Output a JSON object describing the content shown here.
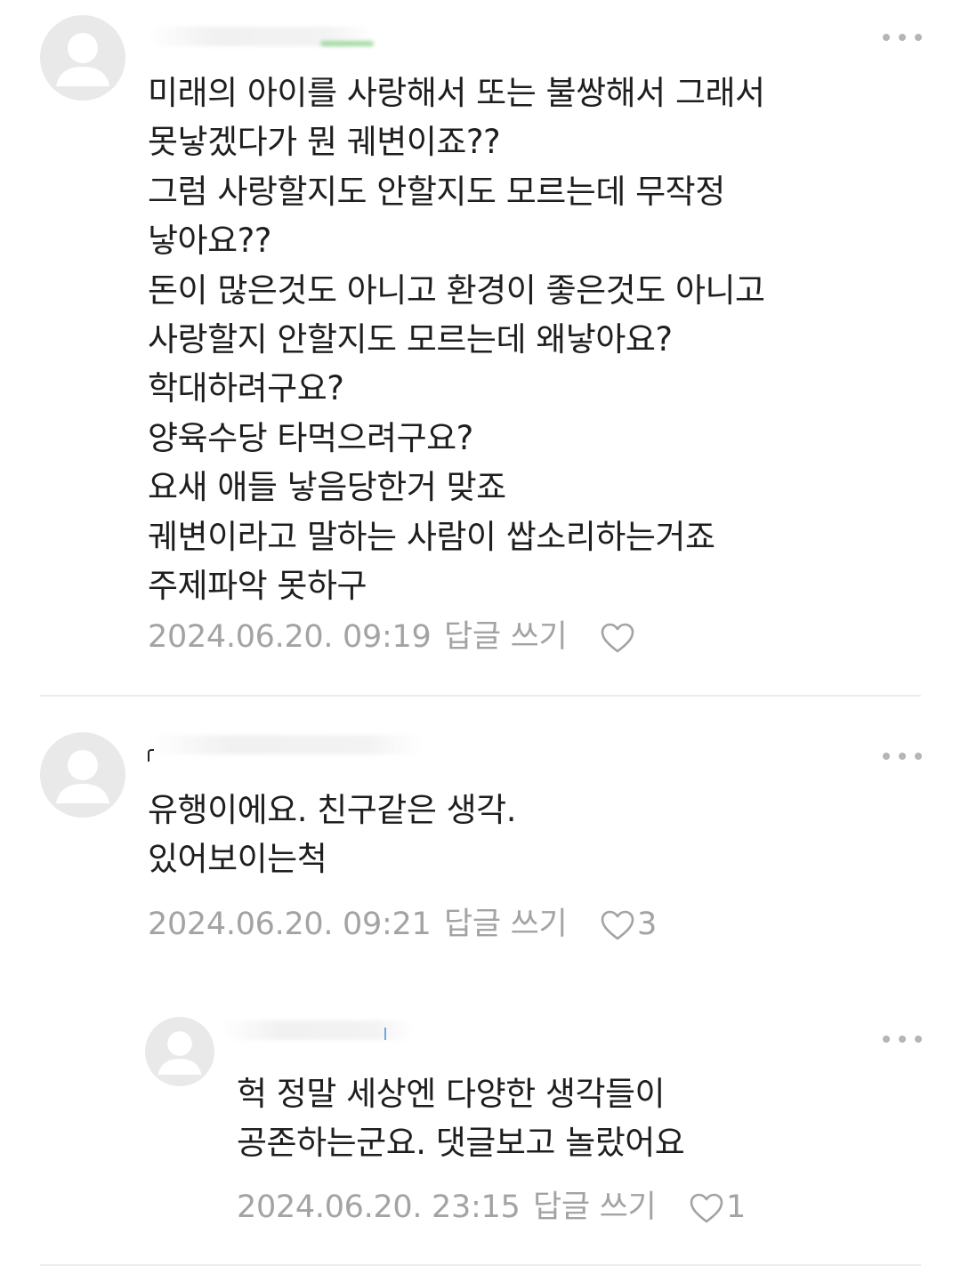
{
  "comments": [
    {
      "lines": [
        "미래의 아이를 사랑해서 또는 불쌍해서 그래서",
        "못낳겠다가 뭔 궤변이죠??",
        "그럼 사랑할지도 안할지도 모르는데 무작정",
        "낳아요??",
        "돈이 많은것도 아니고 환경이 좋은것도 아니고",
        "사랑할지 안할지도 모르는데 왜낳아요?",
        "학대하려구요?",
        "양육수당 타먹으려구요?",
        "요새 애들 낳음당한거 맞죠",
        "궤변이라고 말하는 사람이 쌉소리하는거죠",
        "주제파악 못하구"
      ],
      "date": "2024.06.20. 09:19",
      "reply_label": "답글 쓰기",
      "like_count": ""
    },
    {
      "lines": [
        "유행이에요. 친구같은 생각.",
        "있어보이는척"
      ],
      "date": "2024.06.20. 09:21",
      "reply_label": "답글 쓰기",
      "like_count": "3"
    },
    {
      "lines": [
        "헉 정말 세상엔 다양한 생각들이",
        "공존하는군요. 댓글보고 놀랐어요"
      ],
      "date": "2024.06.20. 23:15",
      "reply_label": "답글 쓰기",
      "like_count": "1"
    }
  ],
  "icons": {
    "avatar": "default-user-avatar-icon",
    "more": "more-options-icon",
    "like": "heart-outline-icon"
  },
  "colors": {
    "text": "#1e1e1e",
    "meta": "#a3a3a3",
    "avatar_bg": "#e9e9e9",
    "divider": "#ececec"
  }
}
